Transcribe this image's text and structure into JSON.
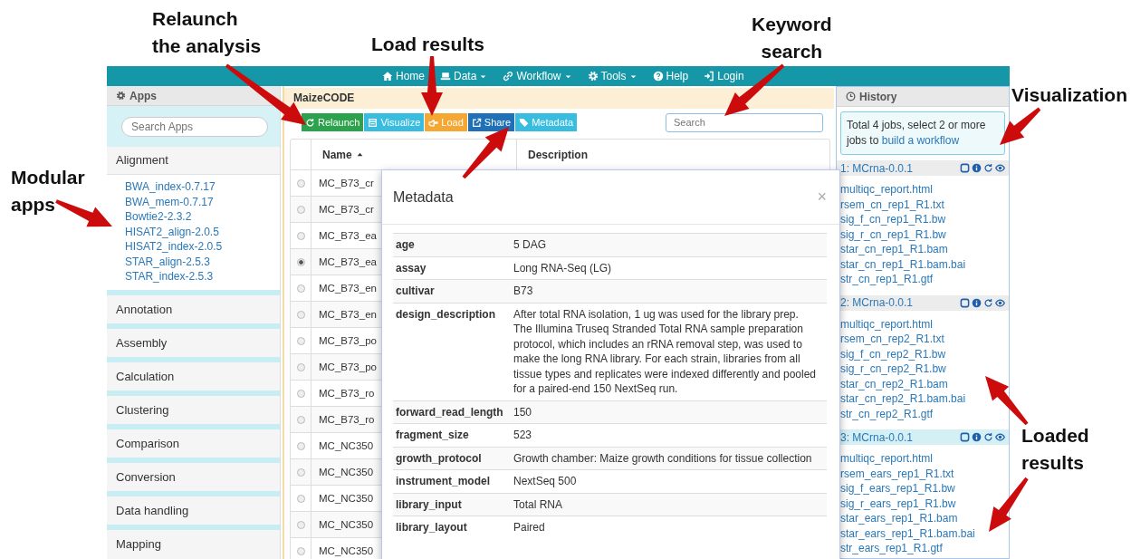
{
  "annotations": [
    {
      "text": "Relaunch\nthe analysis"
    },
    {
      "text": "Load results"
    },
    {
      "text": "Keyword\nsearch"
    },
    {
      "text": "Visualization"
    },
    {
      "text": "Modular\napps"
    },
    {
      "text": "Loaded\nresults"
    }
  ],
  "navbar": {
    "items": [
      {
        "label": "Home",
        "dropdown": false
      },
      {
        "label": "Data",
        "dropdown": true
      },
      {
        "label": "Workflow",
        "dropdown": true
      },
      {
        "label": "Tools",
        "dropdown": true
      },
      {
        "label": "Help",
        "dropdown": false
      },
      {
        "label": "Login",
        "dropdown": false
      }
    ]
  },
  "sidebar": {
    "title": "Apps",
    "search_placeholder": "Search Apps",
    "categories": [
      {
        "name": "Alignment",
        "expanded": true,
        "apps": [
          "BWA_index-0.7.17",
          "BWA_mem-0.7.17",
          "Bowtie2-2.3.2",
          "HISAT2_align-2.0.5",
          "HISAT2_index-2.0.5",
          "STAR_align-2.5.3",
          "STAR_index-2.5.3"
        ]
      },
      {
        "name": "Annotation",
        "expanded": false
      },
      {
        "name": "Assembly",
        "expanded": false
      },
      {
        "name": "Calculation",
        "expanded": false
      },
      {
        "name": "Clustering",
        "expanded": false
      },
      {
        "name": "Comparison",
        "expanded": false
      },
      {
        "name": "Conversion",
        "expanded": false
      },
      {
        "name": "Data handling",
        "expanded": false
      },
      {
        "name": "Mapping",
        "expanded": false
      }
    ]
  },
  "main": {
    "title": "MaizeCODE",
    "toolbar": [
      {
        "label": "Relaunch",
        "color": "#2ca24c"
      },
      {
        "label": "Visualize",
        "color": "#38bde0"
      },
      {
        "label": "Load",
        "color": "#f5a733"
      },
      {
        "label": "Share",
        "color": "#2070b8"
      },
      {
        "label": "Metadata",
        "color": "#38bde0"
      }
    ],
    "search_placeholder": "Search",
    "table": {
      "columns": [
        {
          "label": "Name",
          "sorted": true
        },
        {
          "label": "Description",
          "sorted": false
        }
      ],
      "rows": [
        {
          "name": "MC_B73_cr",
          "selected": false
        },
        {
          "name": "MC_B73_cr",
          "selected": false
        },
        {
          "name": "MC_B73_ea",
          "selected": false
        },
        {
          "name": "MC_B73_ea",
          "selected": true
        },
        {
          "name": "MC_B73_en",
          "selected": false
        },
        {
          "name": "MC_B73_en",
          "selected": false
        },
        {
          "name": "MC_B73_po",
          "selected": false
        },
        {
          "name": "MC_B73_po",
          "selected": false
        },
        {
          "name": "MC_B73_ro",
          "selected": false
        },
        {
          "name": "MC_B73_ro",
          "selected": false
        },
        {
          "name": "MC_NC350",
          "selected": false
        },
        {
          "name": "MC_NC350",
          "selected": false
        },
        {
          "name": "MC_NC350",
          "selected": false
        },
        {
          "name": "MC_NC350",
          "selected": false
        },
        {
          "name": "MC_NC350",
          "selected": false
        }
      ]
    }
  },
  "modal": {
    "title": "Metadata",
    "close": "×",
    "rows": [
      {
        "key": "age",
        "value": "5 DAG"
      },
      {
        "key": "assay",
        "value": "Long RNA-Seq (LG)"
      },
      {
        "key": "cultivar",
        "value": "B73"
      },
      {
        "key": "design_description",
        "value": "After total RNA isolation, 1 ug was used for the library prep. The Illumina Truseq Stranded Total RNA sample preparation protocol, which includes an rRNA removal step, was used to make the long RNA library. For each strain, libraries from all tissue types and replicates were indexed differently and pooled for a paired-end 150 NextSeq run."
      },
      {
        "key": "forward_read_length",
        "value": "150"
      },
      {
        "key": "fragment_size",
        "value": "523"
      },
      {
        "key": "growth_protocol",
        "value": "Growth chamber: Maize growth conditions for tissue collection"
      },
      {
        "key": "instrument_model",
        "value": "NextSeq 500"
      },
      {
        "key": "library_input",
        "value": "Total RNA"
      },
      {
        "key": "library_layout",
        "value": "Paired"
      }
    ]
  },
  "history": {
    "title": "History",
    "summary": "Total 4 jobs, select 2 or more jobs to",
    "summary_link": "build a workflow",
    "jobs": [
      {
        "title": "1: MCrna-0.0.1",
        "selected": false,
        "files": [
          "multiqc_report.html",
          "rsem_cn_rep1_R1.txt",
          "sig_f_cn_rep1_R1.bw",
          "sig_r_cn_rep1_R1.bw",
          "star_cn_rep1_R1.bam",
          "star_cn_rep1_R1.bam.bai",
          "str_cn_rep1_R1.gtf"
        ]
      },
      {
        "title": "2: MCrna-0.0.1",
        "selected": false,
        "files": [
          "multiqc_report.html",
          "rsem_cn_rep2_R1.txt",
          "sig_f_cn_rep2_R1.bw",
          "sig_r_cn_rep2_R1.bw",
          "star_cn_rep2_R1.bam",
          "star_cn_rep2_R1.bam.bai",
          "str_cn_rep2_R1.gtf"
        ]
      },
      {
        "title": "3: MCrna-0.0.1",
        "selected": true,
        "files": [
          "multiqc_report.html",
          "rsem_ears_rep1_R1.txt",
          "sig_f_ears_rep1_R1.bw",
          "sig_r_ears_rep1_R1.bw",
          "star_ears_rep1_R1.bam",
          "star_ears_rep1_R1.bam.bai",
          "str_ears_rep1_R1.gtf"
        ]
      }
    ]
  }
}
